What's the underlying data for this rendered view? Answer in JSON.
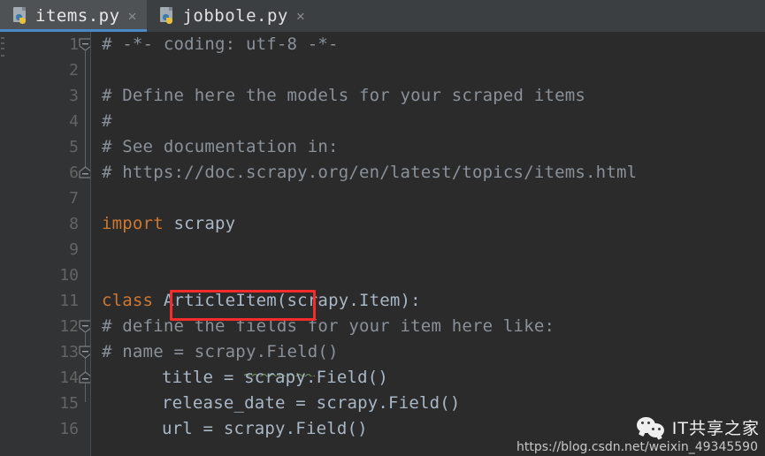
{
  "window": {
    "app": "PyCharm",
    "theme": "darcula",
    "colors": {
      "editor_background": "#2b2b2b",
      "gutter_background": "#313335",
      "tabbar_background": "#3c3f41",
      "active_tab_background": "#4e5254",
      "active_tab_underline": "#4a88c7",
      "keyword": "#cc7832",
      "comment": "#8a9199",
      "text": "#a9b7c6",
      "line_number": "#646464",
      "highlight_box": "#f42c2c",
      "squiggle": "#6a8759"
    }
  },
  "tabs": [
    {
      "label": "items.py",
      "icon": "python-file-icon",
      "close": "×",
      "active": true
    },
    {
      "label": "jobbole.py",
      "icon": "python-file-icon",
      "close": "×",
      "active": false
    }
  ],
  "editor": {
    "file": "items.py",
    "lines": [
      {
        "no": "1",
        "text": "# -*- coding: utf-8 -*-"
      },
      {
        "no": "2",
        "text": ""
      },
      {
        "no": "3",
        "text": "# Define here the models for your scraped items"
      },
      {
        "no": "4",
        "text": "#"
      },
      {
        "no": "5",
        "text": "# See documentation in:"
      },
      {
        "no": "6",
        "text": "# https://doc.scrapy.org/en/latest/topics/items.html"
      },
      {
        "no": "7",
        "text": ""
      },
      {
        "no": "8",
        "text": "import scrapy"
      },
      {
        "no": "9",
        "text": ""
      },
      {
        "no": "10",
        "text": ""
      },
      {
        "no": "11",
        "text": "class ArticleItem(scrapy.Item):"
      },
      {
        "no": "12",
        "text": "    # define the fields for your item here like:"
      },
      {
        "no": "13",
        "text": "    # name = scrapy.Field()"
      },
      {
        "no": "14",
        "text": "    title = scrapy.Field()"
      },
      {
        "no": "15",
        "text": "    release_date = scrapy.Field()"
      },
      {
        "no": "16",
        "text": "    url = scrapy.Field()"
      }
    ],
    "tokens": {
      "line1_comment": "# -*- coding: utf-8 -*-",
      "line3_comment": "# Define here the models for your scraped items",
      "line4_comment": "#",
      "line5_comment": "# See documentation in:",
      "line6_comment": "# https://doc.scrapy.org/en/latest/topics/items.html",
      "line8_keyword": "import",
      "line8_module": "scrapy",
      "line11_keyword": "class",
      "line11_classname": "ArticleItem",
      "line11_rest": "(scrapy.Item):",
      "line12_comment": "# define the fields for your item here like:",
      "line13_comment": "# name = scrapy.Field()",
      "line14_code": "title = scrapy.Field()",
      "line15_code": "release_date = scrapy.Field()",
      "line16_code": "url = scrapy.Field()"
    },
    "highlight": {
      "target": "ArticleItem",
      "line": "11"
    },
    "fold_markers": [
      {
        "line": "1",
        "type": "fold-start"
      },
      {
        "line": "6",
        "type": "fold-end"
      },
      {
        "line": "11",
        "type": "fold-start"
      },
      {
        "line": "12",
        "type": "fold-start"
      },
      {
        "line": "13",
        "type": "fold-end"
      }
    ]
  },
  "watermark": {
    "brand": "IT共享之家",
    "url": "https://blog.csdn.net/weixin_49345590",
    "icon": "wechat-icon"
  }
}
